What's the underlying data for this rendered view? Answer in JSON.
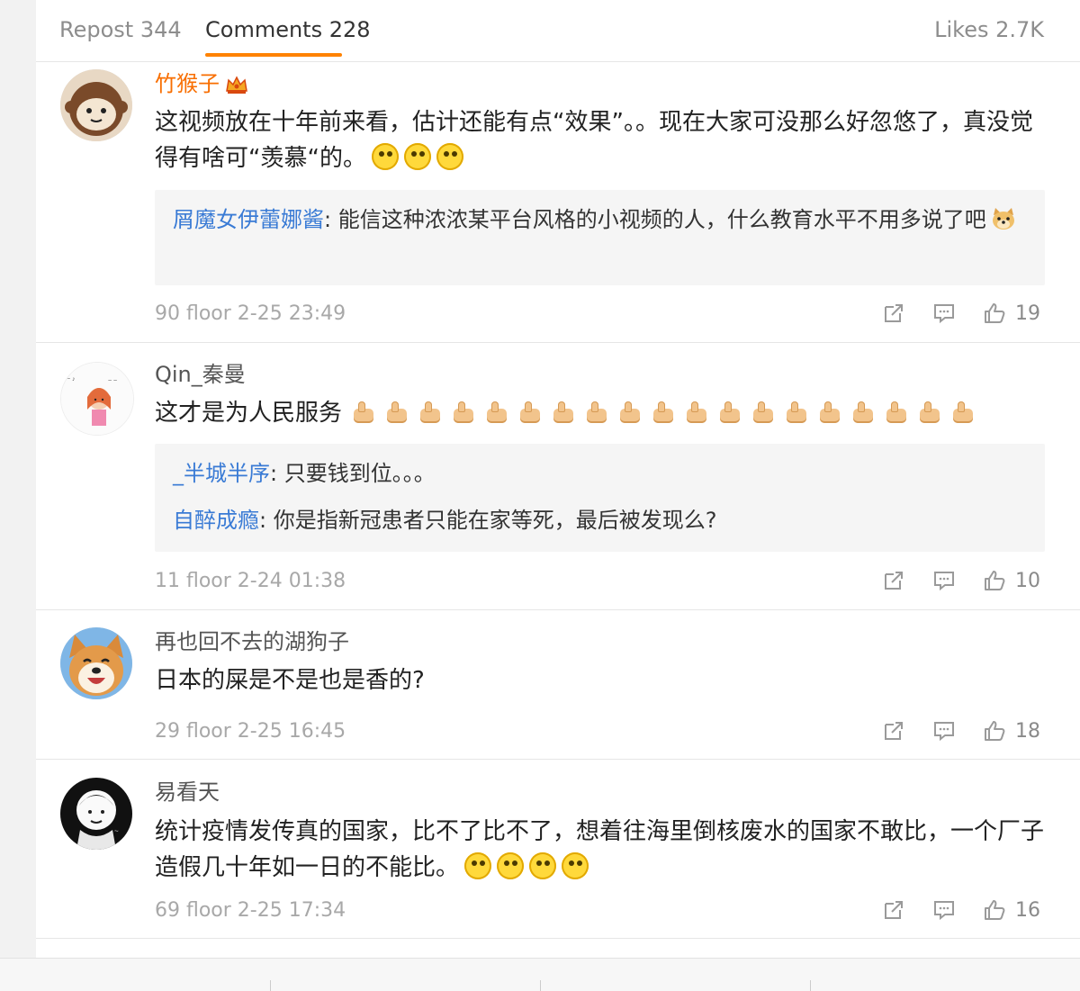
{
  "tabs": {
    "repost": "Repost 344",
    "comments": "Comments 228",
    "likes": "Likes 2.7K"
  },
  "colors": {
    "accent": "#ff8200",
    "vip_name": "#f86e00",
    "reply_name": "#3a7bd5"
  },
  "comments": [
    {
      "username": "竹猴子",
      "vip_badge": "crown-icon",
      "text": "这视频放在十年前来看，估计还能有点“效果”。。现在大家可没那么好忽悠了，真没觉得有啥可“羡慕“的。",
      "emojis": [
        "thinking-emoji",
        "thinking-emoji",
        "thinking-emoji"
      ],
      "replies": [
        {
          "name": "屑魔女伊蕾娜酱",
          "text": ": 能信这种浓浓某平台风格的小视频的人，什么教育水平不用多说了吧"
        }
      ],
      "meta": "90 floor 2-25 23:49",
      "likes": "19"
    },
    {
      "username": "Qin_秦曼",
      "text": "这才是为人民服务",
      "emoji_count": 19,
      "replies": [
        {
          "name": "_半城半序",
          "text": ": 只要钱到位。。。"
        },
        {
          "name": "自醉成瘾",
          "text": ": 你是指新冠患者只能在家等死，最后被发现么?"
        }
      ],
      "meta": "11 floor 2-24 01:38",
      "likes": "10"
    },
    {
      "username": "再也回不去的湖狗子",
      "text": "日本的屎是不是也是香的?",
      "meta": "29 floor 2-25 16:45",
      "likes": "18"
    },
    {
      "username": "易看天",
      "text": "统计疫情发传真的国家，比不了比不了，想着往海里倒核废水的国家不敢比，一个厂子造假几十年如一日的不能比。",
      "emojis": [
        "thinking-emoji",
        "thinking-emoji",
        "thinking-emoji",
        "thinking-emoji"
      ],
      "meta": "69 floor 2-25 17:34",
      "likes": "16"
    }
  ]
}
